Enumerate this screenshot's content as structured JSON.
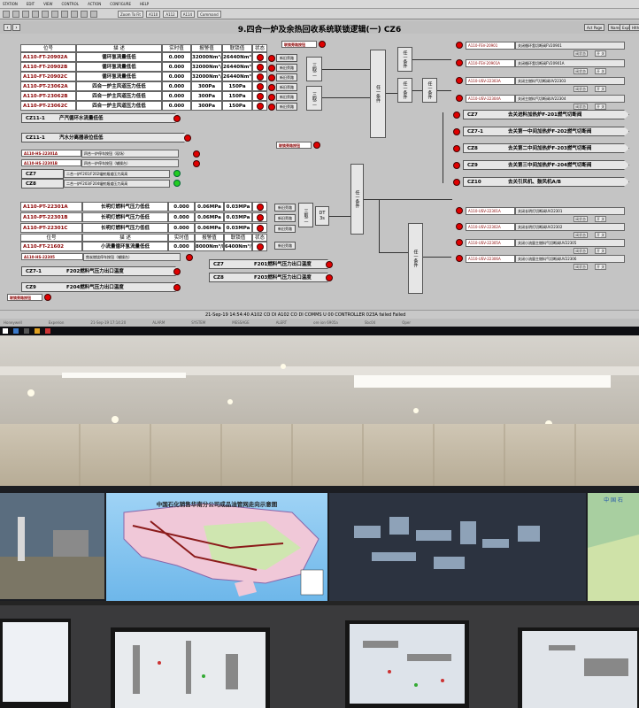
{
  "menu": [
    "STATION",
    "EDIT",
    "VIEW",
    "CONTROL",
    "ACTION",
    "CONFIGURE",
    "HELP"
  ],
  "toolbar": {
    "zoom": "Zoom To Fit",
    "b1": "A110",
    "b2": "A112",
    "b3": "A114",
    "b4": "Command"
  },
  "title": "9.四合一炉及余热回收系统联锁逻辑(一) CZ6",
  "page_buttons": [
    "Act Page",
    "Name",
    "Expl",
    "Hlth"
  ],
  "table1": {
    "headers": [
      "位号",
      "描  述",
      "实时值",
      "报警值",
      "联锁值",
      "状态"
    ],
    "rows": [
      {
        "tag": "A110-FT-20902A",
        "desc": "循环氢流量低低",
        "val": "0.000",
        "alarm": "32000Nm³/h",
        "lock": "26440Nm³/h"
      },
      {
        "tag": "A110-FT-20902B",
        "desc": "循环氢流量低低",
        "val": "0.000",
        "alarm": "32000Nm³/h",
        "lock": "26440Nm³/h"
      },
      {
        "tag": "A110-FT-20902C",
        "desc": "循环氢流量低低",
        "val": "0.000",
        "alarm": "32000Nm³/h",
        "lock": "26440Nm³/h"
      },
      {
        "tag": "A110-PT-23062A",
        "desc": "四合一炉主风道压力低低",
        "val": "0.000",
        "alarm": "300Pa",
        "lock": "150Pa"
      },
      {
        "tag": "A110-PT-23062B",
        "desc": "四合一炉主风道压力低低",
        "val": "0.000",
        "alarm": "300Pa",
        "lock": "150Pa"
      },
      {
        "tag": "A110-PT-23062C",
        "desc": "四合一炉主风道压力低低",
        "val": "0.000",
        "alarm": "300Pa",
        "lock": "150Pa"
      }
    ]
  },
  "table2": {
    "rows": [
      {
        "tag": "A110-PT-22301A",
        "desc": "长明灯燃料气压力低低",
        "val": "0.000",
        "alarm": "0.06MPa",
        "lock": "0.03MPa"
      },
      {
        "tag": "A110-PT-22301B",
        "desc": "长明灯燃料气压力低低",
        "val": "0.000",
        "alarm": "0.06MPa",
        "lock": "0.03MPa"
      },
      {
        "tag": "A110-PT-22301C",
        "desc": "长明灯燃料气压力低低",
        "val": "0.000",
        "alarm": "0.06MPa",
        "lock": "0.03MPa"
      }
    ],
    "headers": [
      "位号",
      "描  述",
      "实时值",
      "报警值",
      "联锁值",
      "状态"
    ],
    "extra": {
      "tag": "A110-FT-21602",
      "desc": "小流量循环氢流量低低",
      "val": "0.000",
      "alarm": "8000Nm³/h",
      "lock": "6400Nm³/h"
    }
  },
  "bypass": "联锁旁路按钮",
  "bypass_short": "新旧旁路",
  "logic": {
    "three_two": "三取二",
    "any_one": "任一条件",
    "dt": "DT 3s"
  },
  "left_inputs": [
    {
      "label": "CZ11-1",
      "desc": "产汽循环水流量低低"
    },
    {
      "label": "CZ11-1",
      "desc": "汽水分离器液位低低"
    }
  ],
  "hs": [
    {
      "tag": "A110-HS-22301A",
      "desc": "四合一炉停车按钮（现场）"
    },
    {
      "tag": "A110-HS-22301B",
      "desc": "四合一炉停车按钮（辅操台）"
    }
  ],
  "cz7": {
    "label": "CZ7",
    "desc": "二合一炉F201/F202辐射烟道压力高高"
  },
  "cz8": {
    "label": "CZ8",
    "desc": "二合一炉F203/F204辐射烟道压力高高"
  },
  "hs_bottom": {
    "tag": "A110-HS-22305",
    "desc": "焦炭燃烧停车按钮（辅操台）"
  },
  "cz71": {
    "label": "CZ7-1",
    "desc": "F202燃料气压力出口温度"
  },
  "cz9": {
    "label": "CZ9",
    "desc": "F204燃料气压力出口温度"
  },
  "mid": [
    {
      "label": "CZ7",
      "desc": "F201燃料气压力出口温度"
    },
    {
      "label": "CZ8",
      "desc": "F203燃料气压力出口温度"
    }
  ],
  "outputs_top": [
    {
      "tag": "A110-FSV-20901",
      "desc": "关闭循环氢切断阀FV20901"
    },
    {
      "tag": "A110-FSV-20901A",
      "desc": "关闭循环氢切断阀FV20901A"
    },
    {
      "tag": "A110-USV-22303A",
      "desc": "关闭主燃料气切断阀UV22303"
    },
    {
      "tag": "A110-USV-22304A",
      "desc": "关闭主燃料气切断阀UV22304"
    }
  ],
  "cz_right": [
    {
      "label": "CZ7",
      "desc": "去关进料加热炉F-201燃气切断阀"
    },
    {
      "label": "CZ7-1",
      "desc": "去关第一中间加热炉F-202燃气切断阀"
    },
    {
      "label": "CZ8",
      "desc": "去关第二中间加热炉F-203燃气切断阀"
    },
    {
      "label": "CZ9",
      "desc": "去关第三中间加热炉F-204燃气切断阀"
    },
    {
      "label": "CZ10",
      "desc": "去关引风机、鼓风机A/B"
    }
  ],
  "outputs_bottom": [
    {
      "tag": "A110-USV-22301A",
      "desc": "关闭长明灯切断阀UV22301"
    },
    {
      "tag": "A110-USV-22302A",
      "desc": "关闭长明灯切断阀UV22302"
    },
    {
      "tag": "A110-USV-22305A",
      "desc": "关闭小流量主燃料气切断阀UV22305"
    },
    {
      "tag": "A110-USV-22306A",
      "desc": "关闭小流量主燃料气切断阀UV22306"
    }
  ],
  "valve_state": "阀状态",
  "valve_btns": "开  关",
  "status": "21-Sep-19  14:54:40  A102 CO DI   A102 CO DI   COMMS  U 00 CONTROLLER 023A failed  Failed",
  "alarmbar": [
    "Honeywell",
    "Experion",
    "21-Sep-19  17:14:20",
    "ALARM",
    "SYSTEM",
    "MESSAGE",
    "ALERT",
    "ore ion 6905a",
    "Sbc04",
    "Oper"
  ],
  "photo": {
    "map_title": "中国石化销售华南分公司成品油管网走向示意图",
    "right_title": "中 国 石"
  },
  "colors": {
    "red": "#e00000",
    "green": "#22cc22",
    "panel": "#c4c4c4"
  }
}
